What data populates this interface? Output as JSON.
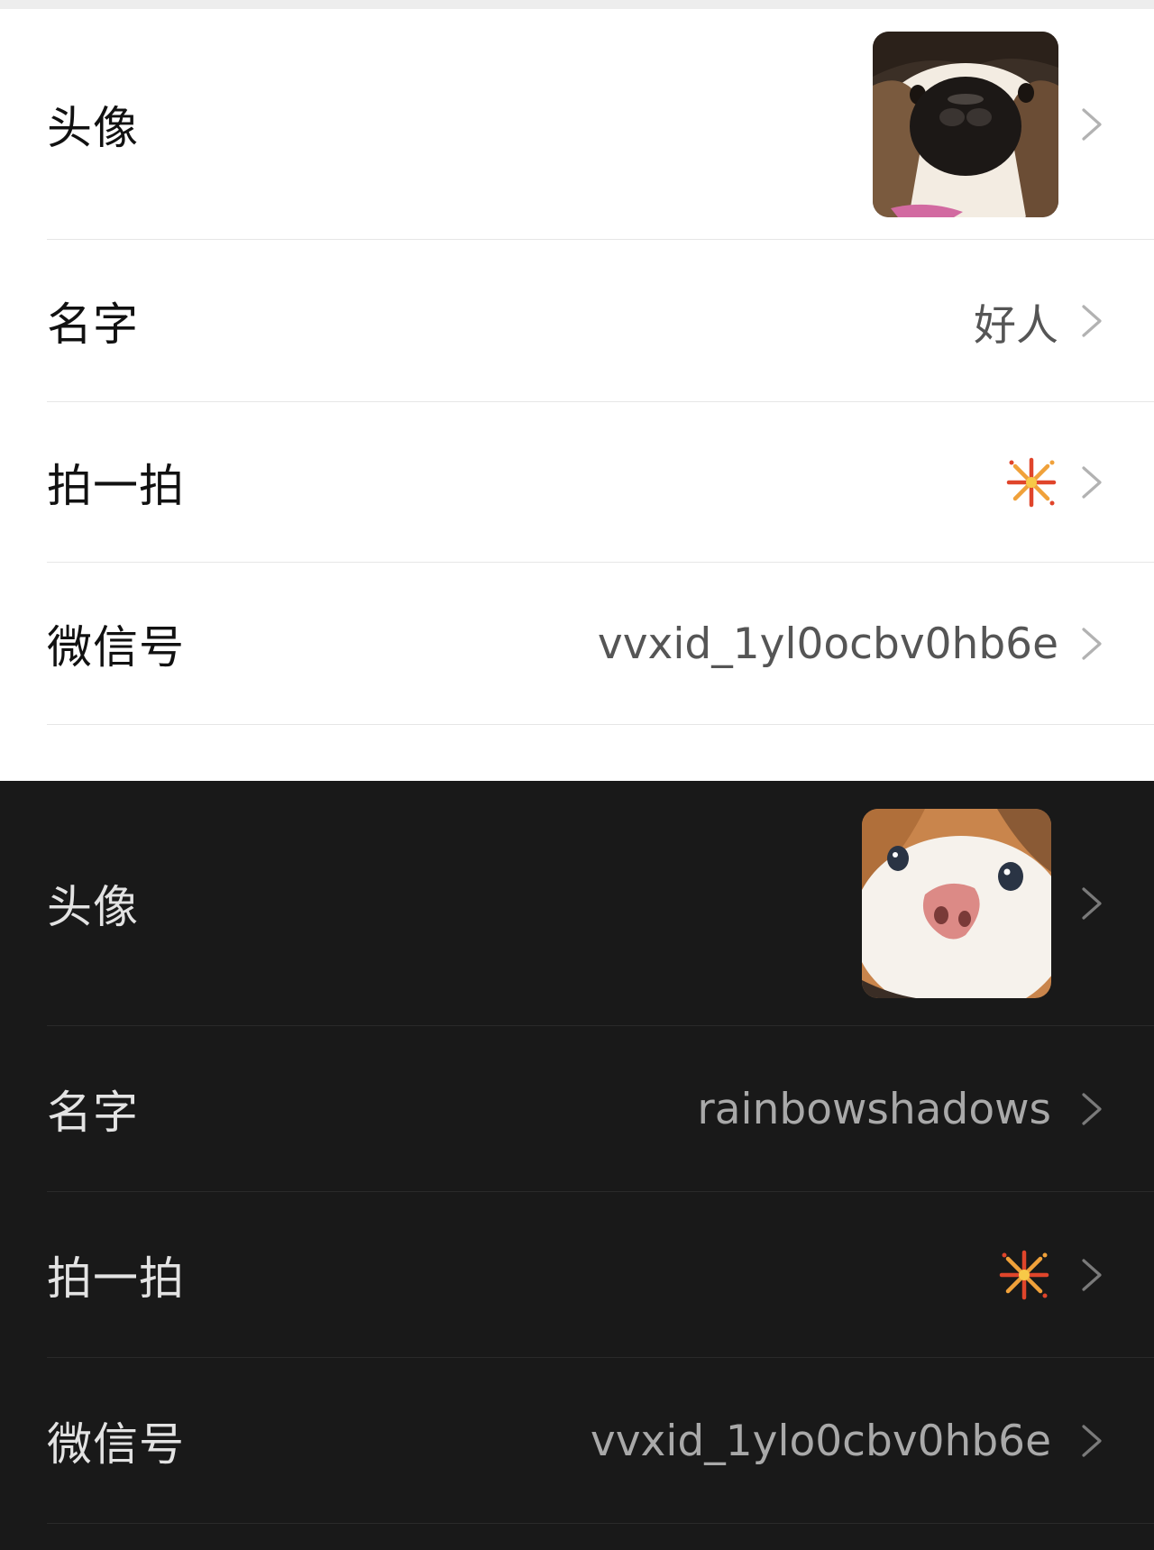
{
  "light_panel": {
    "rows": [
      {
        "label": "头像",
        "type": "avatar",
        "avatar": "dog-face-avatar"
      },
      {
        "label": "名字",
        "type": "text",
        "value": "好人"
      },
      {
        "label": "拍一拍",
        "type": "icon",
        "icon": "firework-icon"
      },
      {
        "label": "微信号",
        "type": "text",
        "value": "vvxid_1yl0ocbv0hb6e"
      }
    ]
  },
  "dark_panel": {
    "rows": [
      {
        "label": "头像",
        "type": "avatar",
        "avatar": "cat-face-avatar"
      },
      {
        "label": "名字",
        "type": "text",
        "value": "rainbowshadows"
      },
      {
        "label": "拍一拍",
        "type": "icon",
        "icon": "firework-icon"
      },
      {
        "label": "微信号",
        "type": "text",
        "value": "vvxid_1ylo0cbv0hb6e"
      }
    ]
  },
  "icons": {
    "chevron": "chevron-right-icon",
    "firework": "firework-icon"
  },
  "colors": {
    "light_bg": "#ffffff",
    "dark_bg": "#191919",
    "chevron_light": "#b2b2b2",
    "chevron_dark": "#7a7a7a"
  }
}
